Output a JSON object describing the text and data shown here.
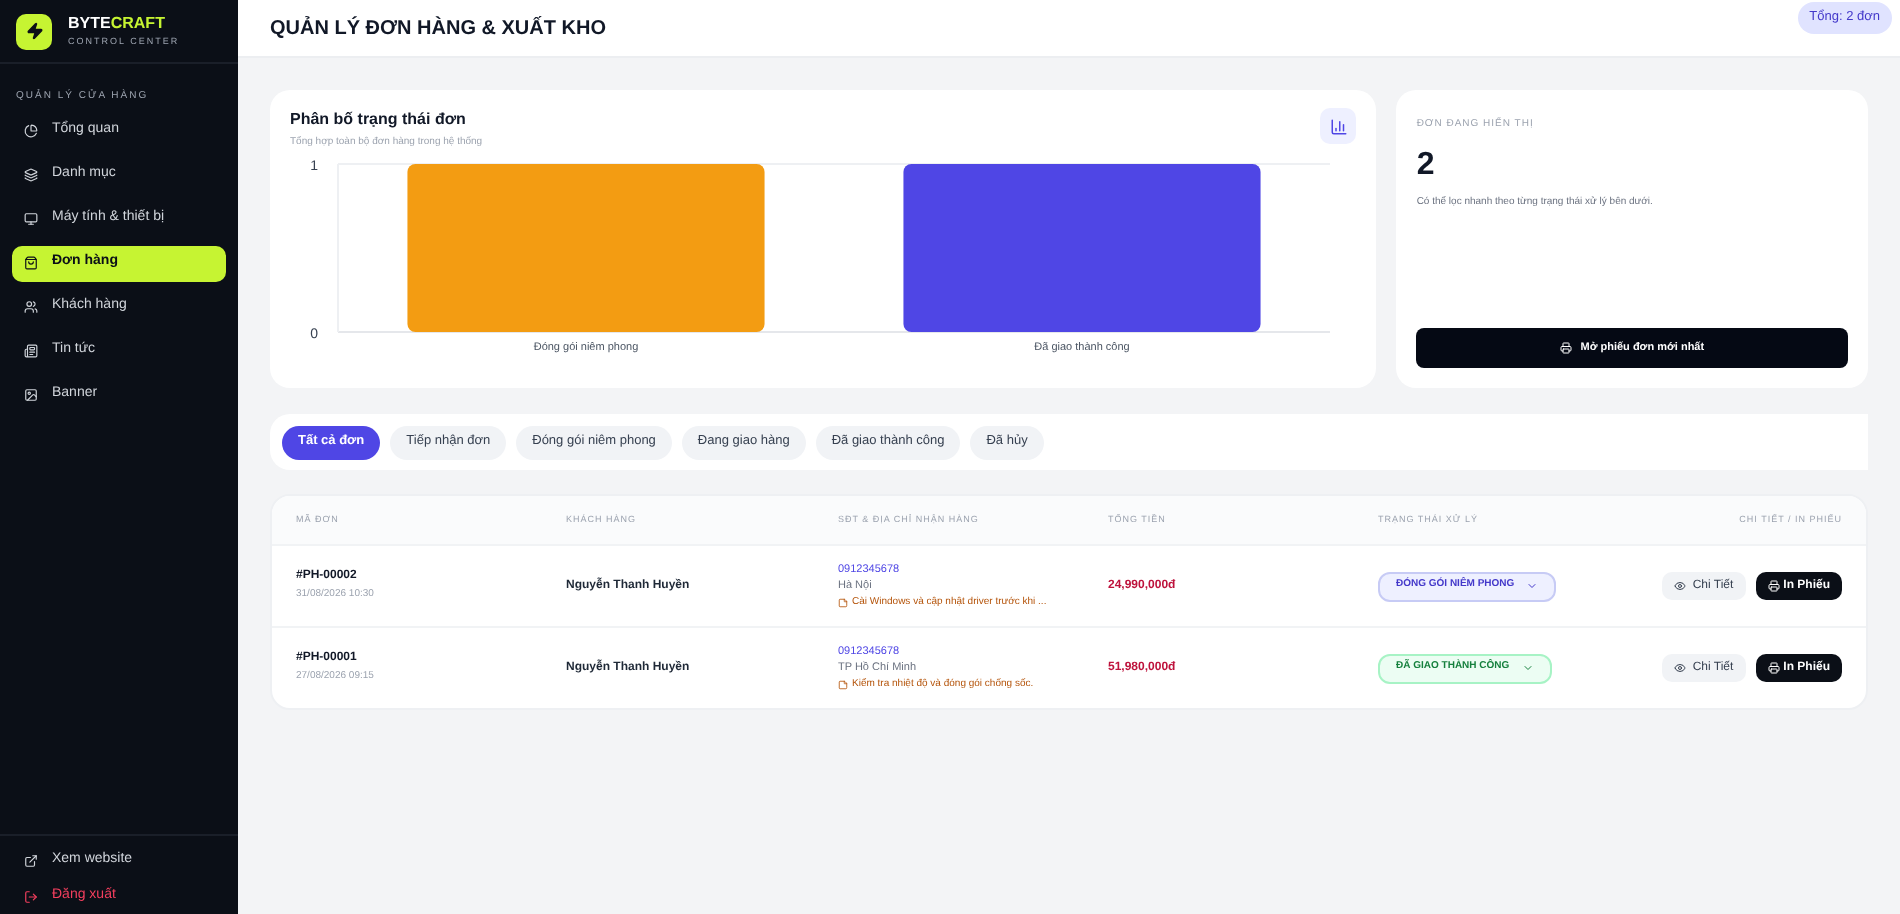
{
  "brand": {
    "name_part1": "BYTE",
    "name_part2": "CRAFT",
    "subtitle": "CONTROL CENTER"
  },
  "sidebar": {
    "section_label": "QUẢN LÝ CỬA HÀNG",
    "items": [
      {
        "label": "Tổng quan",
        "selected": false
      },
      {
        "label": "Danh mục",
        "selected": false
      },
      {
        "label": "Máy tính & thiết bị",
        "selected": false
      },
      {
        "label": "Đơn hàng",
        "selected": true
      },
      {
        "label": "Khách hàng",
        "selected": false
      },
      {
        "label": "Tin tức",
        "selected": false
      },
      {
        "label": "Banner",
        "selected": false
      }
    ],
    "footer": [
      {
        "label": "Xem website",
        "kind": "link"
      },
      {
        "label": "Đăng xuất",
        "kind": "danger"
      }
    ]
  },
  "header": {
    "title": "QUẢN LÝ ĐƠN HÀNG & XUẤT KHO",
    "total_badge": "Tổng: 2 đơn"
  },
  "chart_card": {
    "title": "Phân bố trạng thái đơn",
    "subtitle": "Tổng hợp toàn bộ đơn hàng trong hệ thống",
    "chart_data": {
      "type": "bar",
      "categories": [
        "Đóng gói niêm phong",
        "Đã giao thành công"
      ],
      "values": [
        1,
        1
      ],
      "colors": [
        "#f39c12",
        "#4f46e5"
      ],
      "ylim": [
        0,
        1
      ],
      "yticks": [
        0,
        1
      ]
    }
  },
  "summary_card": {
    "label": "ĐƠN ĐANG HIỂN THỊ",
    "count": "2",
    "note": "Có thể lọc nhanh theo từng trạng thái xử lý bên dưới.",
    "button": "Mở phiếu đơn mới nhất"
  },
  "filter_tabs": [
    {
      "label": "Tất cả đơn",
      "selected": true
    },
    {
      "label": "Tiếp nhận đơn",
      "selected": false
    },
    {
      "label": "Đóng gói niêm phong",
      "selected": false
    },
    {
      "label": "Đang giao hàng",
      "selected": false
    },
    {
      "label": "Đã giao thành công",
      "selected": false
    },
    {
      "label": "Đã hủy",
      "selected": false
    }
  ],
  "table": {
    "columns": [
      "MÃ ĐƠN",
      "KHÁCH HÀNG",
      "SĐT & ĐỊA CHỈ NHẬN HÀNG",
      "TỔNG TIỀN",
      "TRẠNG THÁI XỬ LÝ",
      "CHI TIẾT / IN PHIẾU"
    ],
    "rows": [
      {
        "code": "#PH-00002",
        "date": "31/08/2026 10:30",
        "customer": "Nguyễn Thanh Huyền",
        "phone": "0912345678",
        "address": "Hà Nội",
        "note": "Cài Windows và cập nhật driver trước khi ...",
        "total": "24,990,000đ",
        "status": {
          "label": "ĐÓNG GÓI NIÊM PHONG",
          "kind": "packing"
        },
        "detail_button": "Chi Tiết",
        "print_button": "In Phiếu"
      },
      {
        "code": "#PH-00001",
        "date": "27/08/2026 09:15",
        "customer": "Nguyễn Thanh Huyền",
        "phone": "0912345678",
        "address": "TP Hồ Chí Minh",
        "note": "Kiểm tra nhiệt độ và đóng gói chống sốc.",
        "total": "51,980,000đ",
        "status": {
          "label": "ĐÃ GIAO THÀNH CÔNG",
          "kind": "delivered"
        },
        "detail_button": "Chi Tiết",
        "print_button": "In Phiếu"
      }
    ]
  }
}
